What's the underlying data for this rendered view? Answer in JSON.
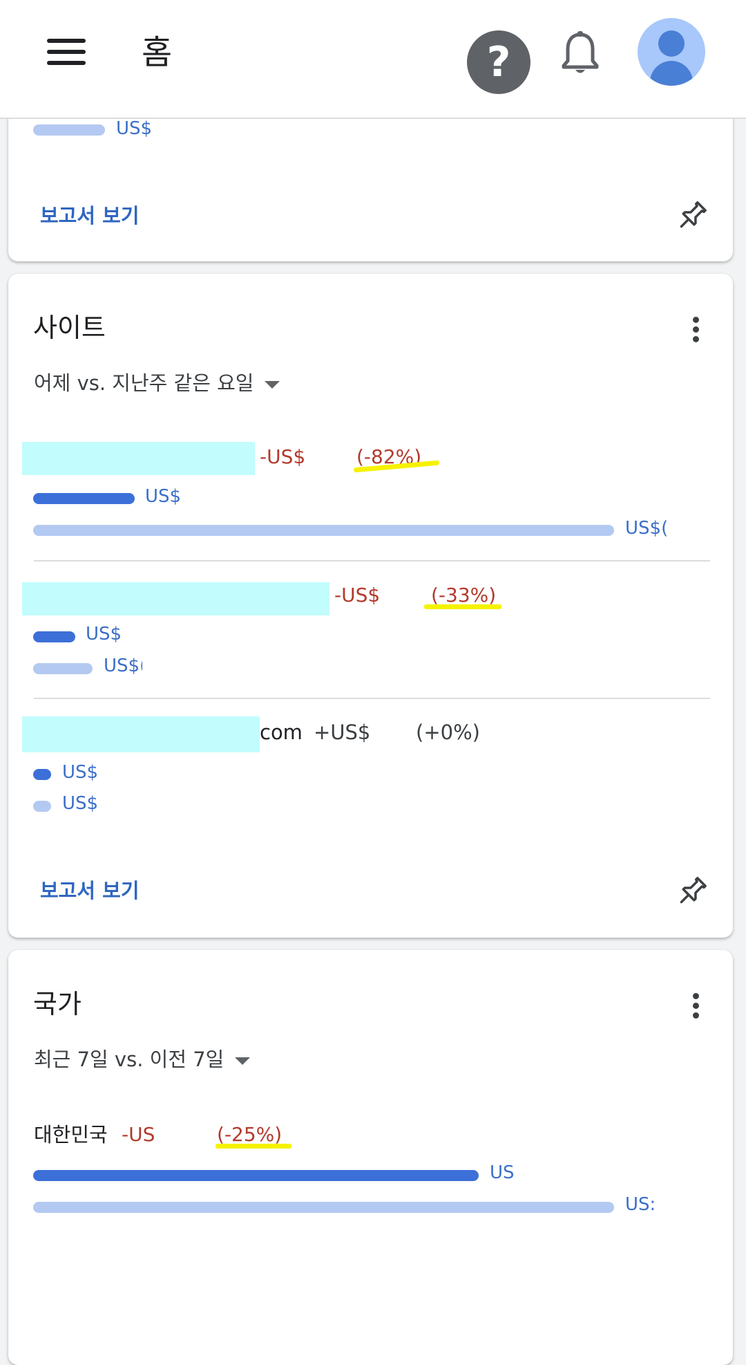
{
  "header": {
    "title": "홈"
  },
  "card_top": {
    "prev_amount": "US$",
    "report_link": "보고서 보기"
  },
  "sites": {
    "title": "사이트",
    "date_range": "어제 vs. 지난주 같은 요일",
    "rows": [
      {
        "name": "",
        "change_amount": "-US$",
        "change_pct": "(-82%)",
        "current": "US$",
        "previous": "US$("
      },
      {
        "name": "",
        "change_amount": "-US$",
        "change_pct": "(-33%)",
        "current": "US$",
        "previous": "US$("
      },
      {
        "name": "com",
        "change_amount": "+US$",
        "change_pct": "(+0%)",
        "current": "US$",
        "previous": "US$"
      }
    ],
    "report_link": "보고서 보기"
  },
  "countries": {
    "title": "국가",
    "date_range": "최근 7일 vs. 이전 7일",
    "rows": [
      {
        "name": "대한민국",
        "change_amount": "-US",
        "change_pct": "(-25%)",
        "current": "US",
        "previous": "US:"
      }
    ]
  },
  "colors": {
    "accent": "#3c6fd8",
    "previous_bar": "#b4c9f1",
    "negative": "#b33a2c",
    "highlight": "#f6f200",
    "redaction": "#c2fcfd"
  },
  "icons": [
    "menu-icon",
    "help-icon",
    "bell-icon",
    "account-avatar-icon",
    "pin-icon",
    "more-vert-icon",
    "dropdown-caret-icon"
  ]
}
